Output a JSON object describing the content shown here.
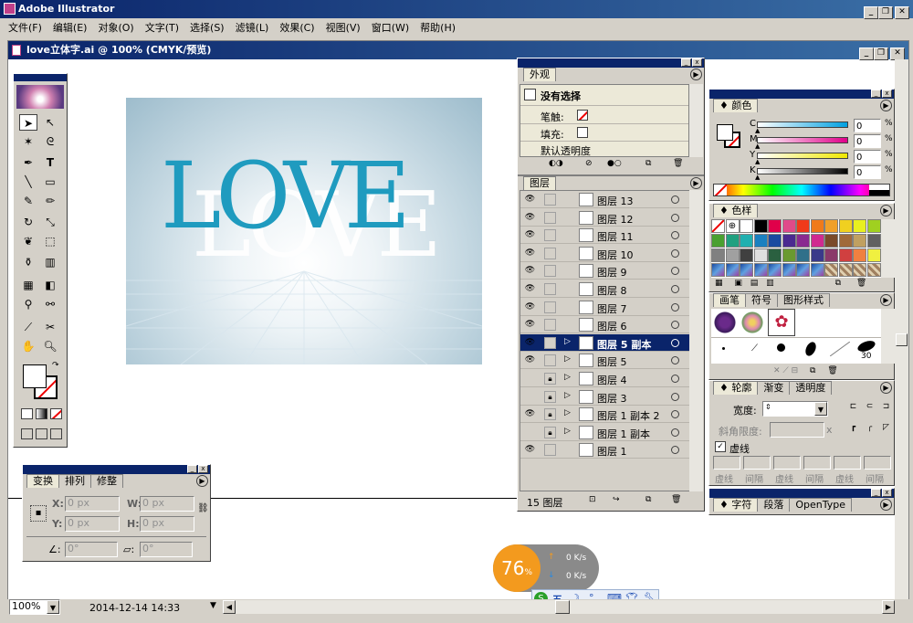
{
  "app": {
    "title": "Adobe Illustrator"
  },
  "menu": [
    "文件(F)",
    "编辑(E)",
    "对象(O)",
    "文字(T)",
    "选择(S)",
    "滤镜(L)",
    "效果(C)",
    "视图(V)",
    "窗口(W)",
    "帮助(H)"
  ],
  "document": {
    "title": "love立体字.ai @ 100% (CMYK/预览)",
    "art_text_front": "LOVE",
    "art_text_back": "LOVE"
  },
  "appearance": {
    "tab": "外观",
    "heading": "没有选择",
    "stroke_label": "笔触:",
    "fill_label": "填充:",
    "opacity_label": "默认透明度"
  },
  "layers": {
    "tab": "图层",
    "count_label": "15 图层",
    "rows": [
      {
        "name": "图层 13",
        "visible": true,
        "locked": false,
        "arrow": false
      },
      {
        "name": "图层 12",
        "visible": true,
        "locked": false,
        "arrow": false
      },
      {
        "name": "图层 11",
        "visible": true,
        "locked": false,
        "arrow": false
      },
      {
        "name": "图层 10",
        "visible": true,
        "locked": false,
        "arrow": false
      },
      {
        "name": "图层 9",
        "visible": true,
        "locked": false,
        "arrow": false
      },
      {
        "name": "图层 8",
        "visible": true,
        "locked": false,
        "arrow": false
      },
      {
        "name": "图层 7",
        "visible": true,
        "locked": false,
        "arrow": false
      },
      {
        "name": "图层 6",
        "visible": true,
        "locked": false,
        "arrow": false
      },
      {
        "name": "图层 5 副本",
        "visible": true,
        "locked": false,
        "arrow": true,
        "selected": true
      },
      {
        "name": "图层 5",
        "visible": true,
        "locked": false,
        "arrow": true
      },
      {
        "name": "图层 4",
        "visible": false,
        "locked": true,
        "arrow": true
      },
      {
        "name": "图层 3",
        "visible": false,
        "locked": true,
        "arrow": true
      },
      {
        "name": "图层 1 副本 2",
        "visible": true,
        "locked": true,
        "arrow": true
      },
      {
        "name": "图层 1 副本",
        "visible": false,
        "locked": true,
        "arrow": true
      },
      {
        "name": "图层 1",
        "visible": true,
        "locked": false,
        "arrow": false
      }
    ]
  },
  "color": {
    "tab": "颜色",
    "channels": [
      {
        "key": "C",
        "value": "0",
        "unit": "%",
        "color": "#00a0e0"
      },
      {
        "key": "M",
        "value": "0",
        "unit": "%",
        "color": "#e0008a"
      },
      {
        "key": "Y",
        "value": "0",
        "unit": "%",
        "color": "#f0e800"
      },
      {
        "key": "K",
        "value": "0",
        "unit": "%",
        "color": "#000000"
      }
    ]
  },
  "swatches": {
    "tab": "色样"
  },
  "brushes": {
    "tabs": [
      "画笔",
      "符号",
      "图形样式"
    ],
    "size_label": "30"
  },
  "stroke": {
    "tabs": [
      "轮廓",
      "渐变",
      "透明度"
    ],
    "weight_label": "宽度:",
    "miter_label": "斜角限度:",
    "miter_unit": "x",
    "dashed_label": "虚线",
    "dash_labels": [
      "虚线",
      "间隔",
      "虚线",
      "间隔",
      "虚线",
      "间隔"
    ]
  },
  "character": {
    "tabs": [
      "字符",
      "段落",
      "OpenType"
    ]
  },
  "transform": {
    "tabs": [
      "变换",
      "排列",
      "修整"
    ],
    "x_label": "X:",
    "y_label": "Y:",
    "w_label": "W:",
    "h_label": "H:",
    "x_value": "0 px",
    "y_value": "0 px",
    "w_value": "0 px",
    "h_value": "0 px",
    "angle_value": "0°",
    "shear_value": "0°"
  },
  "statusbar": {
    "zoom": "100%",
    "datetime": "2014-12-14   14:33"
  },
  "netmeter": {
    "percent": "76",
    "percent_unit": "%",
    "up": "0",
    "up_unit": "K/s",
    "down": "0",
    "down_unit": "K/s"
  },
  "ime": {
    "label": "五"
  }
}
